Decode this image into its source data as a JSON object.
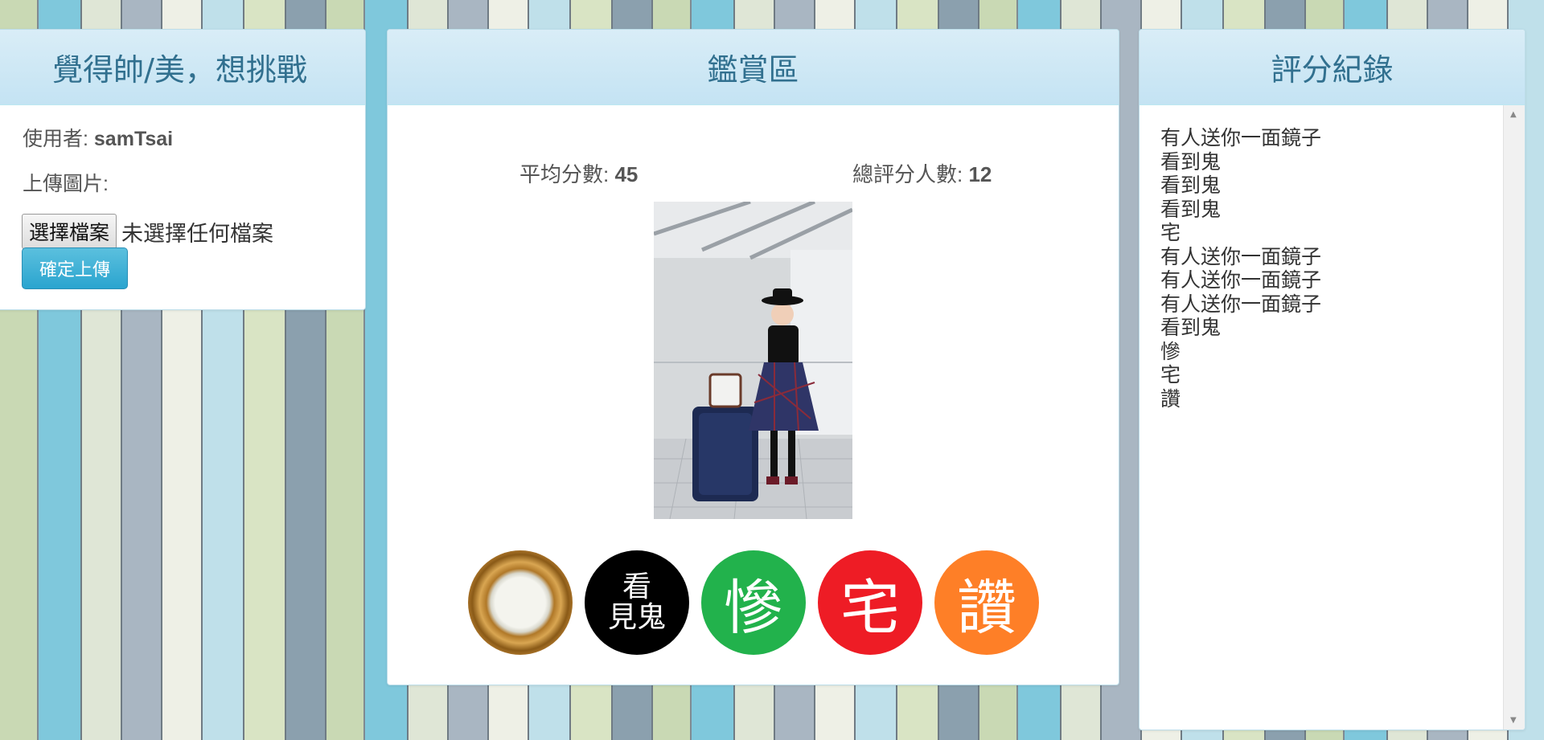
{
  "upload": {
    "title": "覺得帥/美，想挑戰",
    "user_label": "使用者:",
    "username": "samTsai",
    "upload_label": "上傳圖片:",
    "file_button": "選擇檔案",
    "file_status": "未選擇任何檔案",
    "submit_label": "確定上傳"
  },
  "gallery": {
    "title": "鑑賞區",
    "avg_label": "平均分數:",
    "avg_value": "45",
    "count_label": "總評分人數:",
    "count_value": "12",
    "votes": {
      "ghost_line1": "看",
      "ghost_line2": "見鬼",
      "sad": "慘",
      "otaku": "宅",
      "praise": "讚"
    },
    "colors": {
      "ghost": "#000000",
      "sad": "#22b24c",
      "otaku": "#ee1c25",
      "praise": "#fe7f27"
    }
  },
  "records": {
    "title": "評分紀錄",
    "items": [
      "有人送你一面鏡子",
      "看到鬼",
      "看到鬼",
      "看到鬼",
      "宅",
      "有人送你一面鏡子",
      "有人送你一面鏡子",
      "有人送你一面鏡子",
      "看到鬼",
      "慘",
      "宅",
      "讚"
    ]
  }
}
